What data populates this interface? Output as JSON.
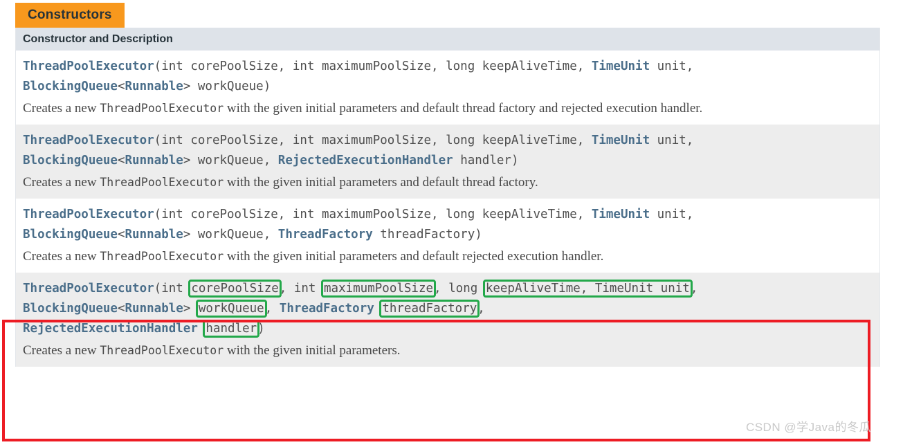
{
  "tab": {
    "label": "Constructors",
    "color": "#F8981D"
  },
  "table": {
    "header": "Constructor and Description",
    "header_bg": "#DEE3E9",
    "rows": [
      {
        "signature_parts": [
          {
            "text": "ThreadPoolExecutor",
            "kind": "type"
          },
          {
            "text": "(int corePoolSize, int maximumPoolSize, long keepAliveTime, ",
            "kind": "plain"
          },
          {
            "text": "TimeUnit",
            "kind": "type"
          },
          {
            "text": " unit,\n",
            "kind": "plain"
          },
          {
            "text": "BlockingQueue",
            "kind": "type"
          },
          {
            "text": "<",
            "kind": "plain"
          },
          {
            "text": "Runnable",
            "kind": "type"
          },
          {
            "text": "> workQueue)",
            "kind": "plain"
          }
        ],
        "description": "Creates a new ThreadPoolExecutor with the given initial parameters and default thread factory and rejected execution handler.",
        "description_mono": "ThreadPoolExecutor",
        "background": "#ffffff"
      },
      {
        "signature_parts": [
          {
            "text": "ThreadPoolExecutor",
            "kind": "type"
          },
          {
            "text": "(int corePoolSize, int maximumPoolSize, long keepAliveTime, ",
            "kind": "plain"
          },
          {
            "text": "TimeUnit",
            "kind": "type"
          },
          {
            "text": " unit,\n",
            "kind": "plain"
          },
          {
            "text": "BlockingQueue",
            "kind": "type"
          },
          {
            "text": "<",
            "kind": "plain"
          },
          {
            "text": "Runnable",
            "kind": "type"
          },
          {
            "text": "> workQueue, ",
            "kind": "plain"
          },
          {
            "text": "RejectedExecutionHandler",
            "kind": "type"
          },
          {
            "text": " handler)",
            "kind": "plain"
          }
        ],
        "description": "Creates a new ThreadPoolExecutor with the given initial parameters and default thread factory.",
        "description_mono": "ThreadPoolExecutor",
        "background": "#ededed"
      },
      {
        "signature_parts": [
          {
            "text": "ThreadPoolExecutor",
            "kind": "type"
          },
          {
            "text": "(int corePoolSize, int maximumPoolSize, long keepAliveTime, ",
            "kind": "plain"
          },
          {
            "text": "TimeUnit",
            "kind": "type"
          },
          {
            "text": " unit,\n",
            "kind": "plain"
          },
          {
            "text": "BlockingQueue",
            "kind": "type"
          },
          {
            "text": "<",
            "kind": "plain"
          },
          {
            "text": "Runnable",
            "kind": "type"
          },
          {
            "text": "> workQueue, ",
            "kind": "plain"
          },
          {
            "text": "ThreadFactory",
            "kind": "type"
          },
          {
            "text": " threadFactory)",
            "kind": "plain"
          }
        ],
        "description": "Creates a new ThreadPoolExecutor with the given initial parameters and default rejected execution handler.",
        "description_mono": "ThreadPoolExecutor",
        "background": "#ffffff"
      },
      {
        "signature_parts": [
          {
            "text": "ThreadPoolExecutor",
            "kind": "type"
          },
          {
            "text": "(int ",
            "kind": "plain"
          },
          {
            "text": "corePoolSize",
            "kind": "plain",
            "highlight": true
          },
          {
            "text": ", int ",
            "kind": "plain"
          },
          {
            "text": "maximumPoolSize",
            "kind": "plain",
            "highlight": true
          },
          {
            "text": ", long ",
            "kind": "plain"
          },
          {
            "text": "keepAliveTime, TimeUnit unit",
            "kind": "plain",
            "highlight": true
          },
          {
            "text": ",\n",
            "kind": "plain"
          },
          {
            "text": "BlockingQueue",
            "kind": "type"
          },
          {
            "text": "<",
            "kind": "plain"
          },
          {
            "text": "Runnable",
            "kind": "type"
          },
          {
            "text": "> ",
            "kind": "plain"
          },
          {
            "text": "workQueue",
            "kind": "plain",
            "highlight": true
          },
          {
            "text": ", ",
            "kind": "plain"
          },
          {
            "text": "ThreadFactory",
            "kind": "type"
          },
          {
            "text": " ",
            "kind": "plain"
          },
          {
            "text": "threadFactory",
            "kind": "plain",
            "highlight": true
          },
          {
            "text": ",\n",
            "kind": "plain"
          },
          {
            "text": "RejectedExecutionHandler",
            "kind": "type"
          },
          {
            "text": " ",
            "kind": "plain"
          },
          {
            "text": "handler",
            "kind": "plain",
            "highlight": true
          },
          {
            "text": ")",
            "kind": "plain"
          }
        ],
        "description": "Creates a new ThreadPoolExecutor with the given initial parameters.",
        "description_mono": "ThreadPoolExecutor",
        "background": "#ededed",
        "annotated": true
      }
    ]
  },
  "annotations": {
    "red_box_color": "#ED1C24",
    "green_box_color": "#23A84A",
    "highlighted_parameters": [
      "corePoolSize",
      "maximumPoolSize",
      "keepAliveTime, TimeUnit unit",
      "workQueue",
      "threadFactory",
      "handler"
    ]
  },
  "watermark": {
    "text": "CSDN @学Java的冬瓜"
  }
}
